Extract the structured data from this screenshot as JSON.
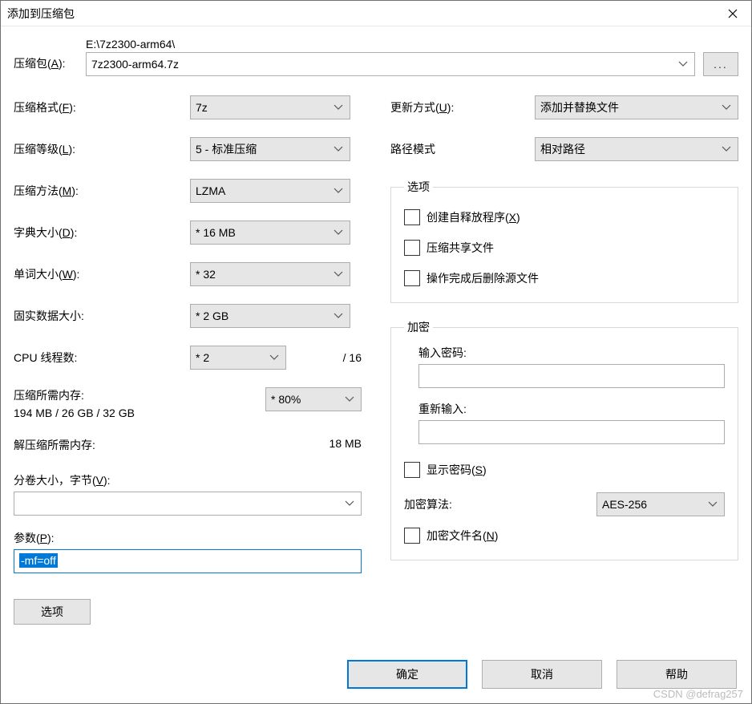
{
  "window": {
    "title": "添加到压缩包"
  },
  "archive": {
    "label_html": "压缩包(<u>A</u>):",
    "path": "E:\\7z2300-arm64\\",
    "filename": "7z2300-arm64.7z",
    "browse": "..."
  },
  "left": {
    "format": {
      "label_html": "压缩格式(<u>F</u>):",
      "value": "7z"
    },
    "level": {
      "label_html": "压缩等级(<u>L</u>):",
      "value": "5 - 标准压缩"
    },
    "method": {
      "label_html": "压缩方法(<u>M</u>):",
      "value": "LZMA"
    },
    "dict": {
      "label_html": "字典大小(<u>D</u>):",
      "value": "*  16 MB"
    },
    "word": {
      "label_html": "单词大小(<u>W</u>):",
      "value": "*  32"
    },
    "solid": {
      "label": "固实数据大小:",
      "value": "*  2 GB"
    },
    "threads": {
      "label": "CPU 线程数:",
      "value": "*  2",
      "max": "/ 16"
    },
    "mem_compress": {
      "label": "压缩所需内存:",
      "percent": "*  80%",
      "detail": "194 MB / 26 GB / 32 GB"
    },
    "mem_decompress": {
      "label": "解压缩所需内存:",
      "value": "18 MB"
    },
    "split": {
      "label_html": "分卷大小，字节(<u>V</u>):",
      "value": ""
    },
    "params": {
      "label_html": "参数(<u>P</u>):",
      "value": "-mf=off"
    },
    "options_btn": "选项"
  },
  "right": {
    "update": {
      "label_html": "更新方式(<u>U</u>):",
      "value": "添加并替换文件"
    },
    "pathmode": {
      "label": "路径模式",
      "value": "相对路径"
    },
    "options": {
      "legend": "选项",
      "sfx_html": "创建自释放程序(<u>X</u>)",
      "shared": "压缩共享文件",
      "delete": "操作完成后删除源文件"
    },
    "encrypt": {
      "legend": "加密",
      "pw_label": "输入密码:",
      "pw2_label": "重新输入:",
      "show_html": "显示密码(<u>S</u>)",
      "algo_label": "加密算法:",
      "algo_value": "AES-256",
      "encnames_html": "加密文件名(<u>N</u>)"
    }
  },
  "buttons": {
    "ok": "确定",
    "cancel": "取消",
    "help": "帮助"
  },
  "watermark": "CSDN @defrag257"
}
